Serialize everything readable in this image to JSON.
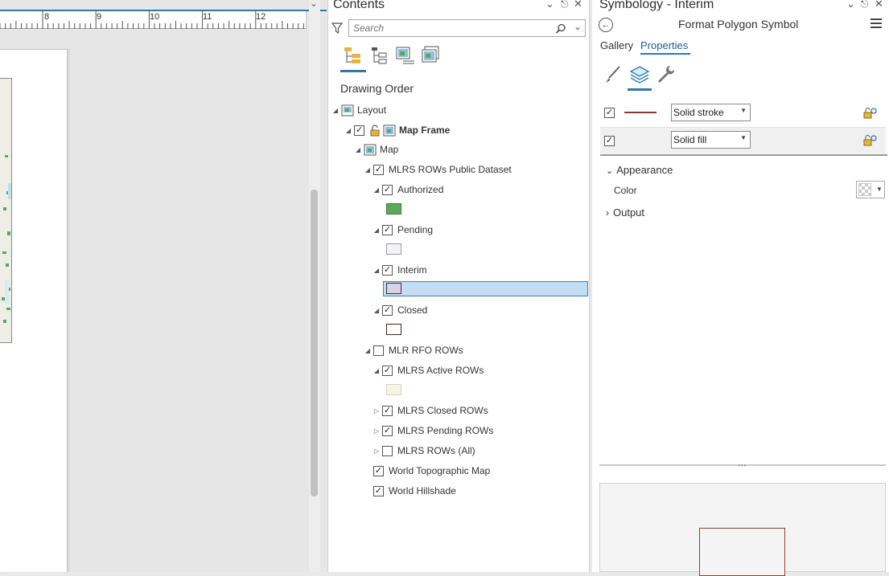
{
  "layout": {
    "ruler_numbers": [
      "8",
      "9",
      "10",
      "11",
      "12"
    ]
  },
  "contents": {
    "title": "Contents",
    "search_placeholder": "Search",
    "drawing_order_label": "Drawing Order",
    "tree": {
      "layout": "Layout",
      "map_frame": "Map Frame",
      "map": "Map",
      "mlrs_rows_public": "MLRS ROWs Public Dataset",
      "authorized": "Authorized",
      "pending": "Pending",
      "interim": "Interim",
      "closed": "Closed",
      "mlr_rfo_rows": "MLR RFO ROWs",
      "mlrs_active_rows": "MLRS Active ROWs",
      "mlrs_closed_rows": "MLRS Closed ROWs",
      "mlrs_pending_rows": "MLRS Pending ROWs",
      "mlrs_rows_all": "MLRS ROWs (All)",
      "world_topographic": "World Topographic Map",
      "world_hillshade": "World Hillshade"
    },
    "swatch_colors": {
      "authorized": "#5aa85a",
      "pending": "#f2f2f7",
      "interim": "#d9d2e6",
      "closed": "#ffffff",
      "active": "#f5f5e6"
    }
  },
  "symbology": {
    "title": "Symbology - Interim",
    "subtitle": "Format Polygon Symbol",
    "tabs": {
      "gallery": "Gallery",
      "properties": "Properties"
    },
    "layers": [
      {
        "label": "Solid stroke",
        "stroke_color": "#8b3a2e"
      },
      {
        "label": "Solid fill"
      }
    ],
    "appearance_label": "Appearance",
    "color_label": "Color",
    "output_label": "Output"
  },
  "colors": {
    "accent": "#2a7ab0",
    "selection": "#c6dcf0"
  }
}
